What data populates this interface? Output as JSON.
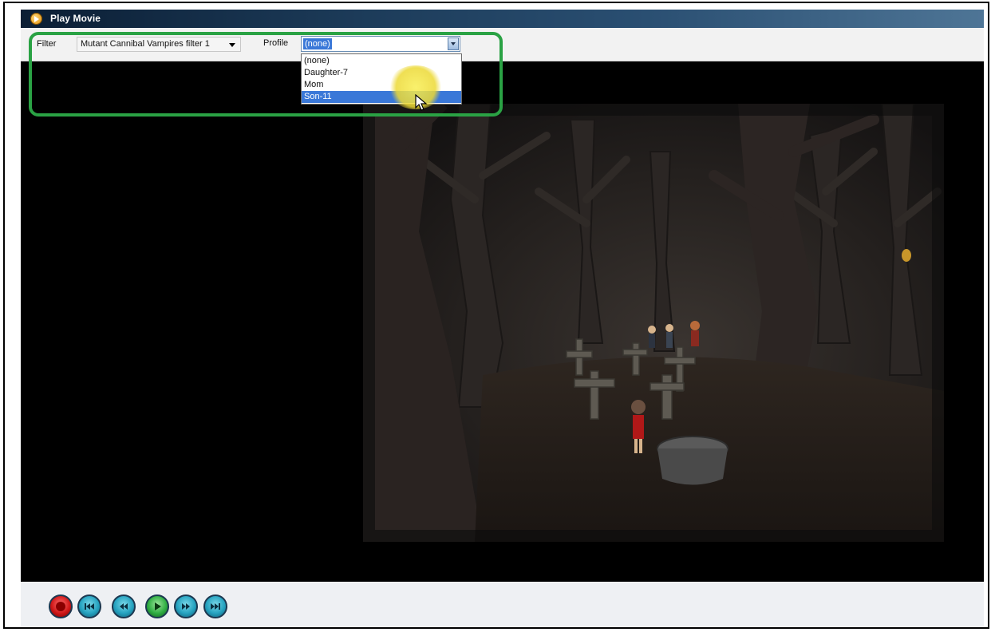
{
  "window": {
    "title": "Play Movie",
    "icon": "play-movie-app-icon"
  },
  "toolbar": {
    "filter_label": "Filter",
    "filter_value": "Mutant Cannibal Vampires filter 1",
    "profile_label": "Profile",
    "profile_value": "(none)",
    "profile_options": [
      "(none)",
      "Daughter-7",
      "Mom",
      "Son-11"
    ],
    "profile_hovered_option": "Son-11"
  },
  "player": {
    "scene": "animated cartoon graveyard in dark forest"
  },
  "controls": [
    {
      "name": "stop-button",
      "icon": "stop-icon",
      "color": "red"
    },
    {
      "name": "skip-back-button",
      "icon": "skip-back-icon",
      "color": "teal"
    },
    {
      "name": "rewind-button",
      "icon": "rewind-icon",
      "color": "teal"
    },
    {
      "name": "play-button",
      "icon": "play-icon",
      "color": "green"
    },
    {
      "name": "fast-forward-button",
      "icon": "fast-forward-icon",
      "color": "teal"
    },
    {
      "name": "skip-forward-button",
      "icon": "skip-forward-icon",
      "color": "teal"
    }
  ],
  "colors": {
    "highlight": "#2aa244",
    "selection": "#3a78d8",
    "titlebar": "#1c3b59"
  }
}
